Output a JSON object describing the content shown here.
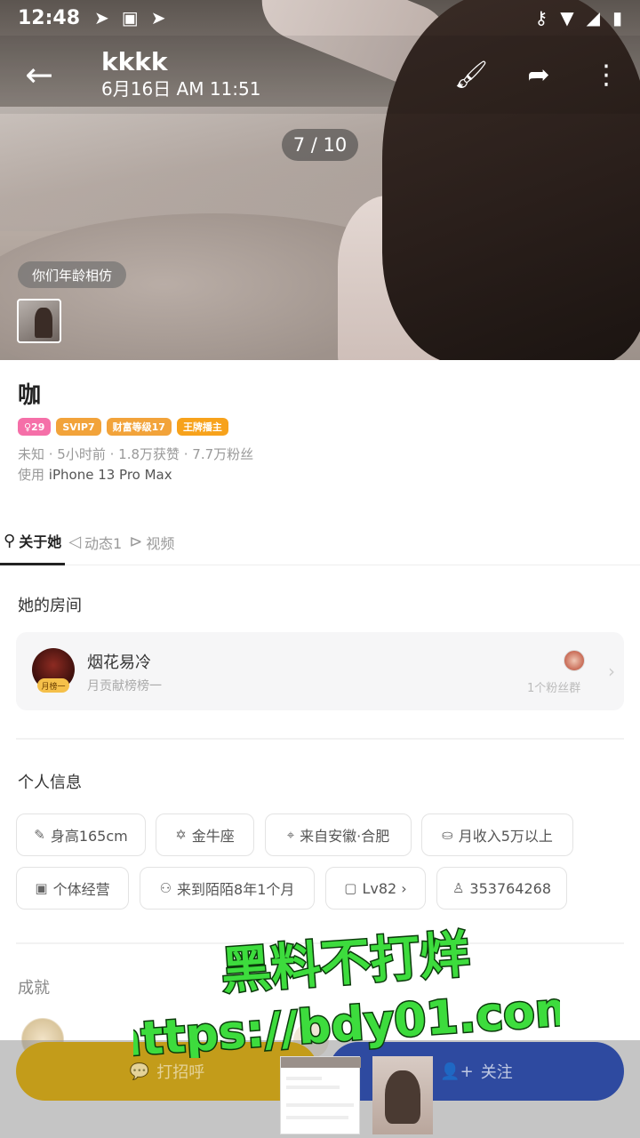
{
  "status_bar": {
    "time": "12:48"
  },
  "header": {
    "title": "kkkk",
    "subtitle": "6月16日 AM 11:51"
  },
  "photo": {
    "counter": "7 / 10",
    "age_hint": "你们年龄相仿"
  },
  "profile": {
    "name": "咖",
    "badges": [
      {
        "text": "♀29",
        "color": "#f56fa8"
      },
      {
        "text": "SVIP7",
        "color": "#f2a33a"
      },
      {
        "text": "财富等级17",
        "color": "#f2a33a"
      },
      {
        "text": "王牌播主",
        "color": "#f7a21b"
      }
    ],
    "meta_line": "未知 · 5小时前 · 1.8万获赞 · 7.7万粉丝",
    "device_prefix": "使用",
    "device": "iPhone 13 Pro Max"
  },
  "tabs": [
    {
      "label": "关于她",
      "icon": "person-icon"
    },
    {
      "label": "动态1",
      "icon": "send-icon"
    },
    {
      "label": "视频",
      "icon": "play-icon"
    }
  ],
  "room": {
    "section_title": "她的房间",
    "name": "烟花易冷",
    "subtitle": "月贡献榜榜一",
    "rank_badge": "月榜一",
    "fans": "1个粉丝群"
  },
  "personal_info": {
    "section_title": "个人信息",
    "chips": [
      {
        "icon": "ruler-icon",
        "glyph": "✎",
        "text": "身高165cm"
      },
      {
        "icon": "zodiac-icon",
        "glyph": "✡",
        "text": "金牛座"
      },
      {
        "icon": "location-icon",
        "glyph": "⌖",
        "text": "来自安徽·合肥"
      },
      {
        "icon": "income-icon",
        "glyph": "⛀",
        "text": "月收入5万以上"
      },
      {
        "icon": "briefcase-icon",
        "glyph": "▣",
        "text": "个体经营"
      },
      {
        "icon": "person-clock-icon",
        "glyph": "⚇",
        "text": "来到陌陌8年1个月"
      },
      {
        "icon": "level-icon",
        "glyph": "▢",
        "text": "Lv82 ›"
      },
      {
        "icon": "user-id-icon",
        "glyph": "♙",
        "text": "353764268"
      }
    ]
  },
  "achievements": {
    "section_title": "成就"
  },
  "bottom": {
    "greet_label": "打招呼",
    "follow_label": "关注"
  },
  "watermark": {
    "line1": "黑料不打烊",
    "line2": "https://bdy01.com"
  },
  "colors": {
    "greet": "#c39c1a",
    "follow": "#2e4aa0",
    "watermark_fill": "#3ddc3d"
  }
}
